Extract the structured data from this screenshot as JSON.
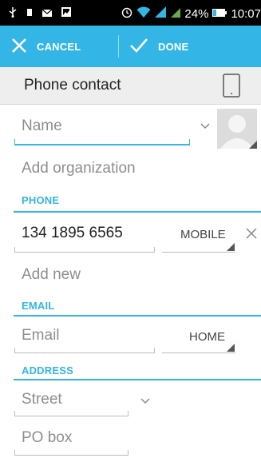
{
  "status_bar": {
    "battery_percent": "24%",
    "time": "10:07"
  },
  "action_bar": {
    "cancel_label": "CANCEL",
    "done_label": "DONE"
  },
  "header": {
    "account_label": "Phone contact"
  },
  "name": {
    "placeholder": "Name"
  },
  "organization": {
    "label": "Add organization"
  },
  "phone": {
    "section_label": "PHONE",
    "value": "134 1895 6565",
    "type": "MOBILE",
    "add_new_label": "Add new"
  },
  "email": {
    "section_label": "EMAIL",
    "placeholder": "Email",
    "type": "HOME"
  },
  "address": {
    "section_label": "ADDRESS",
    "street_placeholder": "Street",
    "pobox_placeholder": "PO box"
  },
  "colors": {
    "accent": "#33b5e5",
    "status_bar": "#000000",
    "header_bg": "#eeeeee"
  }
}
